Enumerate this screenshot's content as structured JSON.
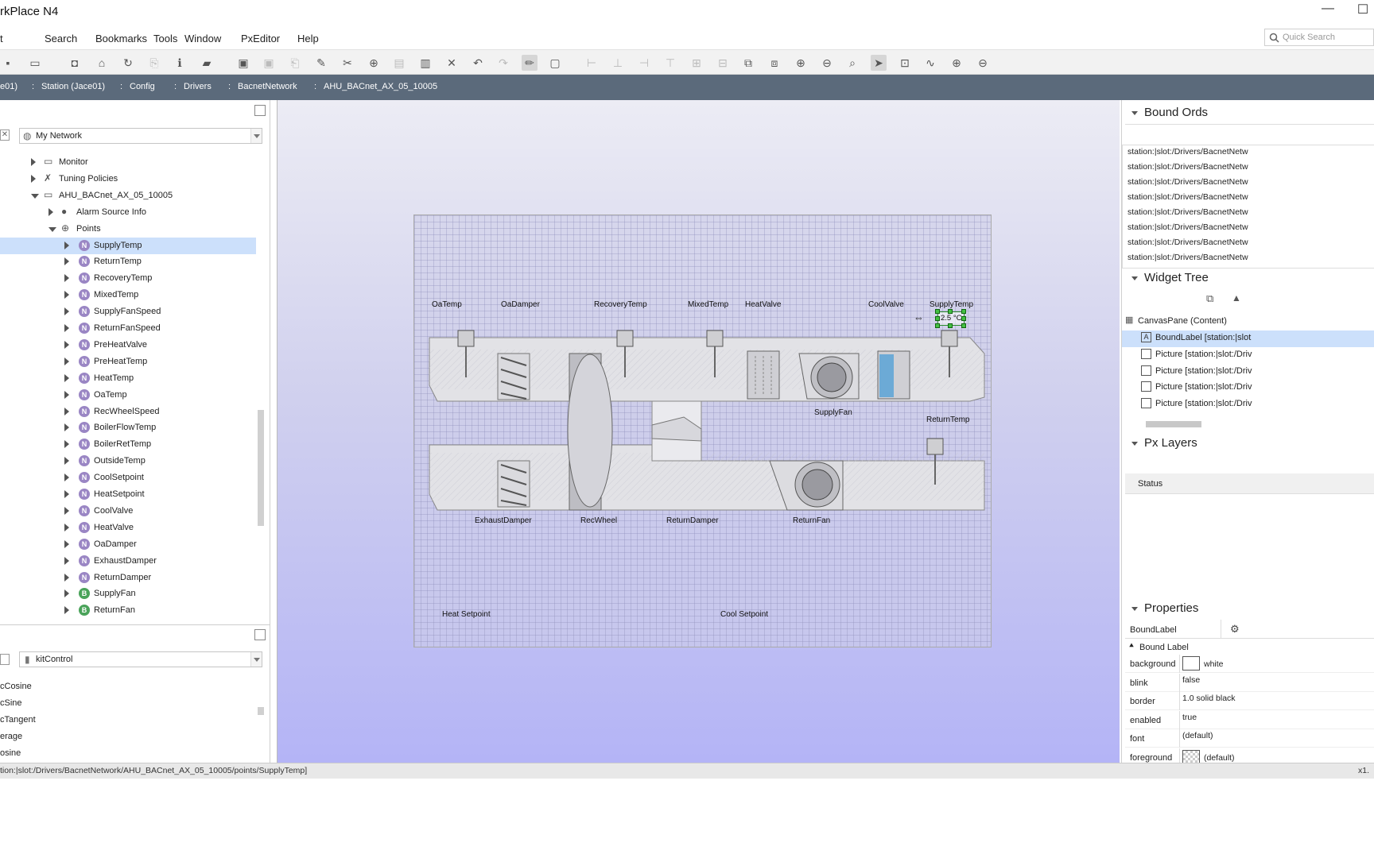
{
  "window": {
    "title": "rkPlace N4"
  },
  "menubar": {
    "items": [
      "t",
      "Search",
      "Bookmarks",
      "Tools",
      "Window",
      "PxEditor",
      "Help"
    ]
  },
  "quick_search": {
    "placeholder": "Quick Search"
  },
  "pathbar": {
    "crumbs": [
      "e01)",
      "Station (Jace01)",
      "Config",
      "Drivers",
      "BacnetNetwork",
      "AHU_BACnet_AX_05_10005"
    ]
  },
  "nav": {
    "selector": "My Network",
    "tree": [
      {
        "label": "Monitor",
        "icon": "monitor-icon",
        "toggle": "right"
      },
      {
        "label": "Tuning Policies",
        "icon": "tuning-icon",
        "toggle": "right"
      },
      {
        "label": "AHU_BACnet_AX_05_10005",
        "icon": "device-icon",
        "toggle": "down"
      },
      {
        "label": "Alarm Source Info",
        "icon": "alarm-icon",
        "toggle": "right"
      },
      {
        "label": "Points",
        "icon": "points-icon",
        "toggle": "down"
      },
      {
        "label": "SupplyTemp",
        "badge": "N",
        "selected": true
      },
      {
        "label": "ReturnTemp",
        "badge": "N"
      },
      {
        "label": "RecoveryTemp",
        "badge": "N"
      },
      {
        "label": "MixedTemp",
        "badge": "N"
      },
      {
        "label": "SupplyFanSpeed",
        "badge": "N"
      },
      {
        "label": "ReturnFanSpeed",
        "badge": "N"
      },
      {
        "label": "PreHeatValve",
        "badge": "N"
      },
      {
        "label": "PreHeatTemp",
        "badge": "N"
      },
      {
        "label": "HeatTemp",
        "badge": "N"
      },
      {
        "label": "OaTemp",
        "badge": "N"
      },
      {
        "label": "RecWheelSpeed",
        "badge": "N"
      },
      {
        "label": "BoilerFlowTemp",
        "badge": "N"
      },
      {
        "label": "BoilerRetTemp",
        "badge": "N"
      },
      {
        "label": "OutsideTemp",
        "badge": "N"
      },
      {
        "label": "CoolSetpoint",
        "badge": "N"
      },
      {
        "label": "HeatSetpoint",
        "badge": "N"
      },
      {
        "label": "CoolValve",
        "badge": "N"
      },
      {
        "label": "HeatValve",
        "badge": "N"
      },
      {
        "label": "OaDamper",
        "badge": "N"
      },
      {
        "label": "ExhaustDamper",
        "badge": "N"
      },
      {
        "label": "ReturnDamper",
        "badge": "N"
      },
      {
        "label": "SupplyFan",
        "badge": "B"
      },
      {
        "label": "ReturnFan",
        "badge": "B"
      }
    ]
  },
  "palette": {
    "selector": "kitControl",
    "items": [
      "cCosine",
      "cSine",
      "cTangent",
      "erage",
      "osine"
    ]
  },
  "canvas": {
    "labels": {
      "oa_temp": "OaTemp",
      "oa_damper": "OaDamper",
      "recovery_temp": "RecoveryTemp",
      "mixed_temp": "MixedTemp",
      "heat_valve": "HeatValve",
      "cool_valve": "CoolValve",
      "supply_temp": "SupplyTemp",
      "supply_fan": "SupplyFan",
      "return_temp": "ReturnTemp",
      "exhaust_damper": "ExhaustDamper",
      "rec_wheel": "RecWheel",
      "return_damper": "ReturnDamper",
      "return_fan": "ReturnFan",
      "heat_setpoint": "Heat Setpoint",
      "cool_setpoint": "Cool Setpoint"
    },
    "selected_value": "2.5 °C"
  },
  "bound_ords": {
    "title": "Bound Ords",
    "items": [
      "station:|slot:/Drivers/BacnetNetw",
      "station:|slot:/Drivers/BacnetNetw",
      "station:|slot:/Drivers/BacnetNetw",
      "station:|slot:/Drivers/BacnetNetw",
      "station:|slot:/Drivers/BacnetNetw",
      "station:|slot:/Drivers/BacnetNetw",
      "station:|slot:/Drivers/BacnetNetw",
      "station:|slot:/Drivers/BacnetNetw"
    ]
  },
  "widget_tree": {
    "title": "Widget Tree",
    "root": "CanvasPane (Content)",
    "items": [
      {
        "label": "BoundLabel [station:|slot",
        "icon": "label-icon",
        "selected": true
      },
      {
        "label": "Picture [station:|slot:/Driv",
        "icon": "picture-icon"
      },
      {
        "label": "Picture [station:|slot:/Driv",
        "icon": "picture-icon"
      },
      {
        "label": "Picture [station:|slot:/Driv",
        "icon": "picture-icon"
      },
      {
        "label": "Picture [station:|slot:/Driv",
        "icon": "picture-icon"
      }
    ]
  },
  "px_layers": {
    "title": "Px Layers",
    "column": "Status"
  },
  "properties": {
    "title": "Properties",
    "selected": "BoundLabel",
    "group": "Bound Label",
    "rows": [
      {
        "key": "background",
        "value": "white",
        "swatch": "#ffffff"
      },
      {
        "key": "blink",
        "value": "false"
      },
      {
        "key": "border",
        "value": "1.0 solid black"
      },
      {
        "key": "enabled",
        "value": "true"
      },
      {
        "key": "font",
        "value": "(default)"
      },
      {
        "key": "foreground",
        "value": "(default)",
        "swatch": "checker"
      }
    ]
  },
  "statusbar": {
    "text": "tion:|slot:/Drivers/BacnetNetwork/AHU_BACnet_AX_05_10005/points/SupplyTemp]",
    "right": "x1."
  },
  "colors": {
    "pathbar": "#5b6a7b",
    "selection": "#cce0fb",
    "badge_numeric": "#9a86c4",
    "badge_boolean": "#4aa35a",
    "canvas_bottom": "#b4b4f6"
  }
}
